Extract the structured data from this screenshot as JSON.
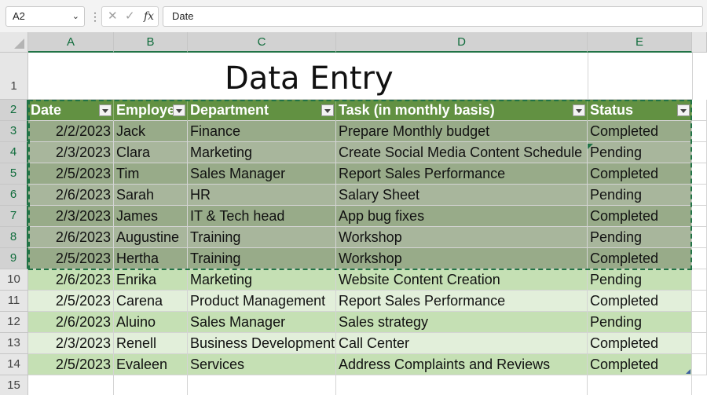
{
  "formula_bar": {
    "name_box": "A2",
    "formula": "Date",
    "fx_label": "fx"
  },
  "columns": [
    "A",
    "B",
    "C",
    "D",
    "E"
  ],
  "rows": [
    "1",
    "2",
    "3",
    "4",
    "5",
    "6",
    "7",
    "8",
    "9",
    "10",
    "11",
    "12",
    "13",
    "14",
    "15"
  ],
  "title": "Data Entry",
  "headers": [
    "Date",
    "Employee",
    "Department",
    "Task (in monthly basis)",
    "Status"
  ],
  "table_rows": [
    [
      "2/2/2023",
      "Jack",
      "Finance",
      "Prepare Monthly budget",
      "Completed"
    ],
    [
      "2/3/2023",
      "Clara",
      "Marketing",
      "Create Social Media Content Schedule",
      "Pending"
    ],
    [
      "2/5/2023",
      "Tim",
      "Sales Manager",
      "Report Sales Performance",
      "Completed"
    ],
    [
      "2/6/2023",
      "Sarah",
      "HR",
      "Salary Sheet",
      "Pending"
    ],
    [
      "2/3/2023",
      "James",
      "IT & Tech head",
      "App bug fixes",
      "Completed"
    ],
    [
      "2/6/2023",
      "Augustine",
      "Training",
      "Workshop",
      "Pending"
    ],
    [
      "2/5/2023",
      "Hertha",
      "Training",
      "Workshop",
      "Completed"
    ],
    [
      "2/6/2023",
      "Enrika",
      "Marketing",
      "Website Content Creation",
      "Pending"
    ],
    [
      "2/5/2023",
      "Carena",
      "Product Management",
      "Report Sales Performance",
      "Completed"
    ],
    [
      "2/6/2023",
      "Aluino",
      "Sales Manager",
      "Sales strategy",
      "Pending"
    ],
    [
      "2/3/2023",
      "Renell",
      "Business Development",
      "Call Center",
      "Completed"
    ],
    [
      "2/5/2023",
      "Evaleen",
      "Services",
      "Address Complaints and Reviews",
      "Completed"
    ]
  ],
  "colors": {
    "header_fill": "#629142",
    "selected_band_dark": "#98ab89",
    "selected_band_light": "#a8b69c",
    "band_dark": "#c5e0b4",
    "band_light": "#e2efda",
    "selection_border": "#217346"
  }
}
